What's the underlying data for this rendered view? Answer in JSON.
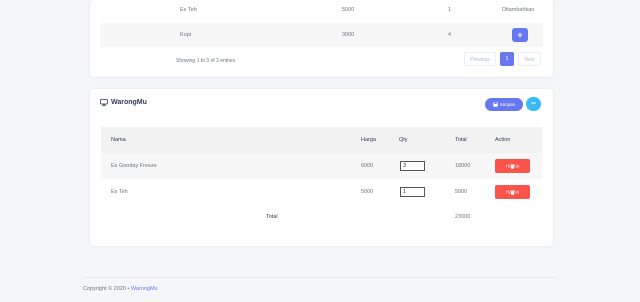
{
  "top_table": {
    "rows": [
      {
        "name": "Es Teh",
        "price": "5000",
        "qty": "1",
        "status": "Ditambahkan"
      },
      {
        "name": "Kopi",
        "price": "3000",
        "qty": "4",
        "add_label": "+"
      }
    ],
    "showing": "Showing 1 to 3 of 3 entries",
    "pagination": {
      "previous": "Previous",
      "page": "1",
      "next": "Next"
    }
  },
  "cart": {
    "title": "WarongMu",
    "simpan_label": "Simpan",
    "collapse_label": "−",
    "headers": {
      "nama": "Nama",
      "harga": "Harga",
      "qty": "Qty",
      "total": "Total",
      "action": "Action"
    },
    "rows": [
      {
        "nama": "Es Gooday Freeze",
        "harga": "6000",
        "qty": "3",
        "total": "18000",
        "action": "Hapus"
      },
      {
        "nama": "Es Teh",
        "harga": "5000",
        "qty": "1",
        "total": "5000",
        "action": "Hapus"
      }
    ],
    "footer": {
      "label": "Total",
      "value": "23000"
    }
  },
  "footer": {
    "copyright": "Copyright © 2020",
    "separator": "•",
    "brand": "WarongMu"
  },
  "colors": {
    "primary": "#6777ef",
    "info": "#3abaf4",
    "danger": "#fc544b"
  }
}
